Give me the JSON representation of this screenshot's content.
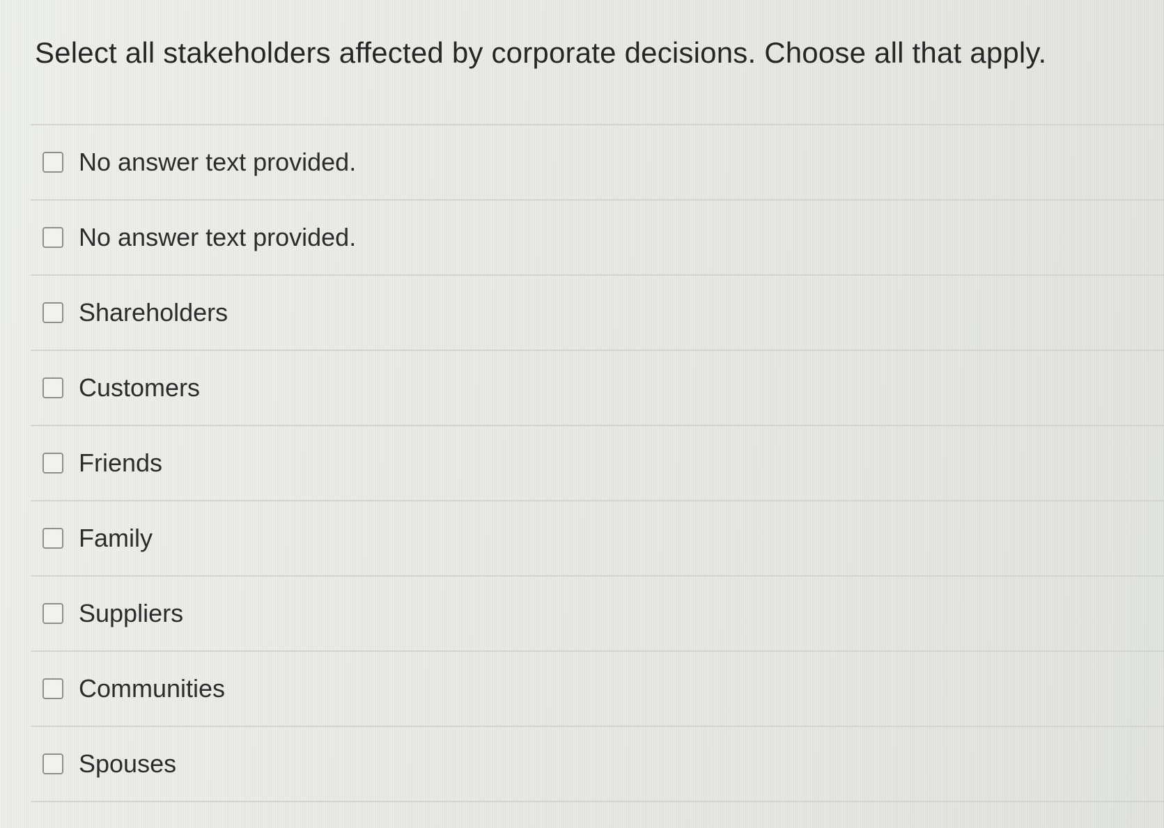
{
  "question": {
    "text": "Select all stakeholders affected by corporate decisions. Choose all that apply."
  },
  "options": [
    {
      "label": "No answer text provided.",
      "checked": false
    },
    {
      "label": "No answer text provided.",
      "checked": false
    },
    {
      "label": "Shareholders",
      "checked": false
    },
    {
      "label": "Customers",
      "checked": false
    },
    {
      "label": "Friends",
      "checked": false
    },
    {
      "label": "Family",
      "checked": false
    },
    {
      "label": "Suppliers",
      "checked": false
    },
    {
      "label": "Communities",
      "checked": false
    },
    {
      "label": "Spouses",
      "checked": false
    }
  ]
}
